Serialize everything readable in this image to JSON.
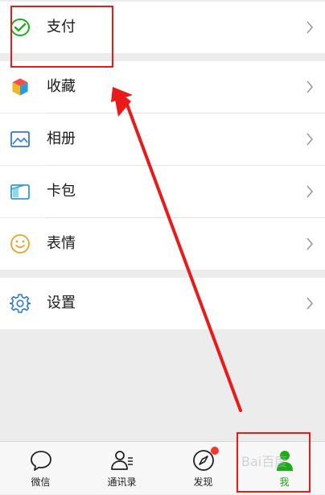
{
  "menu": {
    "pay": {
      "label": "支付",
      "icon": "wallet-check-icon",
      "color": "#1aad19"
    },
    "favorites": {
      "label": "收藏",
      "icon": "cube-icon"
    },
    "album": {
      "label": "相册",
      "icon": "picture-icon",
      "color": "#2d7bd6"
    },
    "cards": {
      "label": "卡包",
      "icon": "card-wallet-icon",
      "color": "#2d9bd6"
    },
    "stickers": {
      "label": "表情",
      "icon": "smiley-icon",
      "color": "#f0a020"
    },
    "settings": {
      "label": "设置",
      "icon": "gear-icon",
      "color": "#2d7bd6"
    }
  },
  "tabbar": {
    "tabs": [
      {
        "label": "微信",
        "icon": "chat-bubble-icon"
      },
      {
        "label": "通讯录",
        "icon": "contacts-icon"
      },
      {
        "label": "发现",
        "icon": "compass-icon",
        "badge": true
      },
      {
        "label": "我",
        "icon": "person-icon",
        "active": true
      }
    ],
    "active_color": "#1aad19"
  },
  "annotation": {
    "color": "#ea1a1a"
  },
  "watermark": "Bai百度"
}
